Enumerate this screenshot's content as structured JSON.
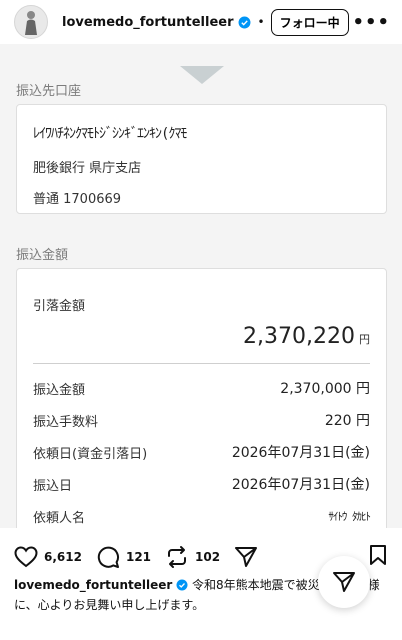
{
  "header": {
    "username": "lovemedo_fortuntelleer",
    "follow_label": "フォロー中",
    "dot": "•",
    "more": "•••"
  },
  "transfer": {
    "dest_section_label": "振込先口座",
    "recipient_kana": "ﾚｲﾜﾊﾁﾈﾝｸﾏﾓﾄｼﾞｼﾝｷﾞｴﾝｷﾝ(ｸﾏﾓ",
    "bank_branch": "肥後銀行 県庁支店",
    "account": "普通 1700669",
    "amount_section_label": "振込金額",
    "hikiotoshi_label": "引落金額",
    "hikiotoshi_amount": "2,370,220",
    "yen": "円",
    "rows": [
      {
        "label": "振込金額",
        "value": "2,370,000 円"
      },
      {
        "label": "振込手数料",
        "value": "220 円"
      },
      {
        "label": "依頼日(資金引落日)",
        "value": "2026年07月31日(金)"
      },
      {
        "label": "振込日",
        "value": "2026年07月31日(金)"
      },
      {
        "label": "依頼人名",
        "value": "ｻｲﾄｳ ﾀｶﾋﾄ"
      }
    ]
  },
  "actions": {
    "likes": "6,612",
    "comments": "121",
    "reposts": "102"
  },
  "caption": {
    "username": "lovemedo_fortuntelleer",
    "text": " 令和8年熊本地震で被災された皆様に、心よりお見舞い申し上げます。"
  },
  "colors": {
    "verified": "#0095f6",
    "section_label": "#7c7c7c",
    "photo_bg": "#f4f4f4"
  }
}
